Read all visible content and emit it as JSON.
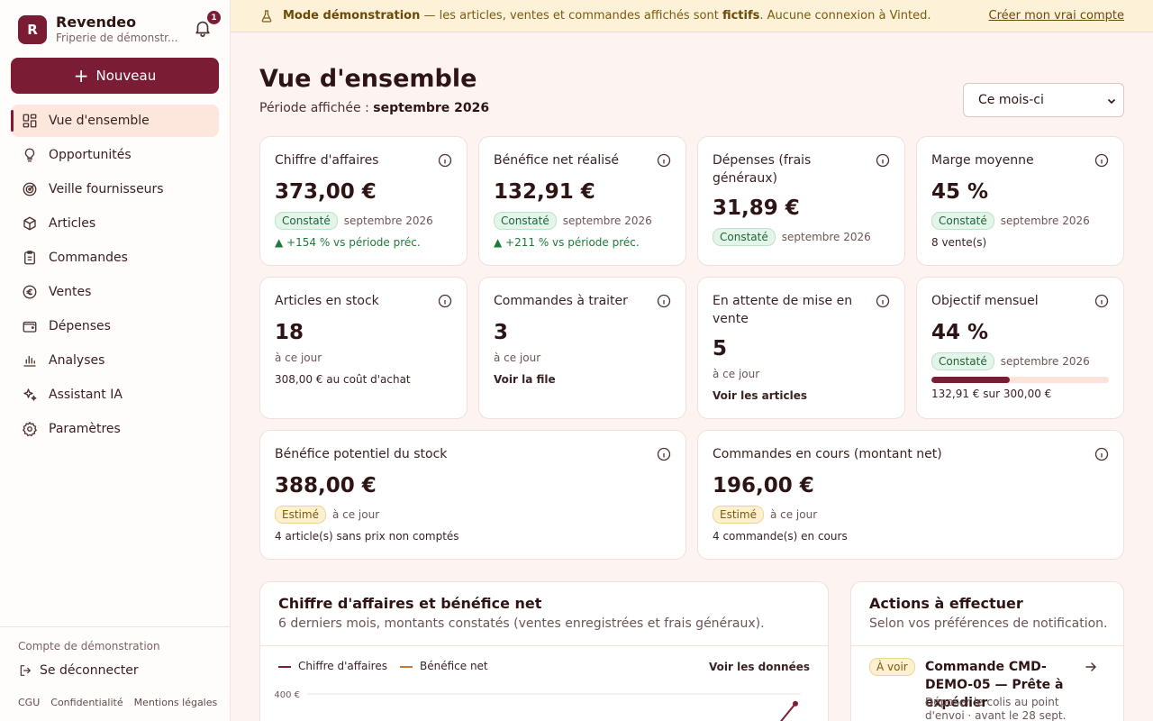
{
  "sidebar": {
    "brand_initial": "R",
    "brand_name": "Revendeo",
    "brand_sub": "Friperie de démonstr...",
    "notif_count": "1",
    "new_label": "Nouveau",
    "items": [
      {
        "label": "Vue d'ensemble",
        "icon": "grid-icon"
      },
      {
        "label": "Opportunités",
        "icon": "bulb-icon"
      },
      {
        "label": "Veille fournisseurs",
        "icon": "radar-icon"
      },
      {
        "label": "Articles",
        "icon": "box-icon"
      },
      {
        "label": "Commandes",
        "icon": "clipboard-icon"
      },
      {
        "label": "Ventes",
        "icon": "euro-icon"
      },
      {
        "label": "Dépenses",
        "icon": "wallet-icon"
      },
      {
        "label": "Analyses",
        "icon": "bar-chart-icon"
      },
      {
        "label": "Assistant IA",
        "icon": "sparkles-icon"
      },
      {
        "label": "Paramètres",
        "icon": "gear-icon"
      }
    ],
    "demo_account": "Compte de démonstration",
    "logout": "Se déconnecter",
    "legal": [
      "CGU",
      "Confidentialité",
      "Mentions légales"
    ]
  },
  "banner": {
    "strong": "Mode démonstration",
    "text1": " — les articles, ventes et commandes affichés sont ",
    "strong2": "fictifs",
    "text2": ". Aucune connexion à Vinted.",
    "cta": "Créer mon vrai compte"
  },
  "header": {
    "title": "Vue d'ensemble",
    "period_label": "Période affichée : ",
    "period_value": "septembre 2026",
    "select_value": "Ce mois-ci"
  },
  "cards": {
    "ca": {
      "title": "Chiffre d'affaires",
      "value": "373,00 €",
      "badge": "Constaté",
      "period": "septembre 2026",
      "trend": "▲ +154 % vs période préc."
    },
    "benef": {
      "title": "Bénéfice net réalisé",
      "value": "132,91 €",
      "badge": "Constaté",
      "period": "septembre 2026",
      "trend": "▲ +211 % vs période préc."
    },
    "depenses": {
      "title": "Dépenses (frais généraux)",
      "value": "31,89 €",
      "badge": "Constaté",
      "period": "septembre 2026"
    },
    "marge": {
      "title": "Marge moyenne",
      "value": "45 %",
      "badge": "Constaté",
      "period": "septembre 2026",
      "note": "8 vente(s)"
    },
    "stock": {
      "title": "Articles en stock",
      "value": "18",
      "sub": "à ce jour",
      "note": "308,00 € au coût d'achat"
    },
    "traiter": {
      "title": "Commandes à traiter",
      "value": "3",
      "sub": "à ce jour",
      "link": "Voir la file"
    },
    "attente": {
      "title": "En attente de mise en vente",
      "value": "5",
      "sub": "à ce jour",
      "link": "Voir les articles"
    },
    "objectif": {
      "title": "Objectif mensuel",
      "value": "44 %",
      "badge": "Constaté",
      "period": "septembre 2026",
      "progress": 0.44,
      "note": "132,91 € sur 300,00 €"
    },
    "potentiel": {
      "title": "Bénéfice potentiel du stock",
      "value": "388,00 €",
      "badge": "Estimé",
      "period": "à ce jour",
      "note": "4 article(s) sans prix non comptés"
    },
    "encours": {
      "title": "Commandes en cours (montant net)",
      "value": "196,00 €",
      "badge": "Estimé",
      "period": "à ce jour",
      "note": "4 commande(s) en cours"
    }
  },
  "chart_panel": {
    "title": "Chiffre d'affaires et bénéfice net",
    "subtitle": "6 derniers mois, montants constatés (ventes enregistrées et frais généraux).",
    "see_data": "Voir les données"
  },
  "chart_data": {
    "type": "line",
    "series": [
      {
        "name": "Chiffre d'affaires",
        "color": "#7a1d34",
        "values": [
          373
        ]
      },
      {
        "name": "Bénéfice net",
        "color": "#c47a3a",
        "values": []
      }
    ],
    "ytick_visible": "400 €",
    "ymax": 400
  },
  "actions_panel": {
    "title": "Actions à effectuer",
    "subtitle": "Selon vos préférences de notification.",
    "item": {
      "badge": "À voir",
      "title": "Commande CMD-DEMO-05 — Prête à expédier",
      "desc": "Déposer le colis au point d'envoi · avant le 28 sept."
    }
  },
  "colors": {
    "brand": "#7a1d34",
    "accent": "#c47a3a"
  }
}
